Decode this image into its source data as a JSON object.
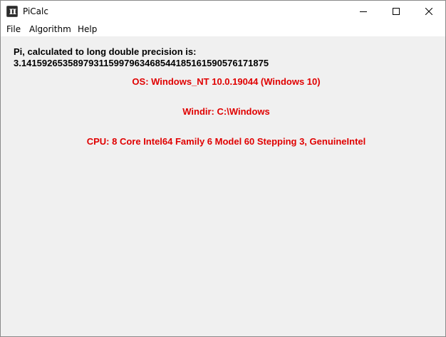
{
  "window": {
    "title": "PiCalc",
    "icon": "pi-icon"
  },
  "menu": {
    "file": "File",
    "algorithm": "Algorithm",
    "help": "Help"
  },
  "content": {
    "pi_label": "Pi, calculated to long double precision is:",
    "pi_value": "3.14159265358979311599796346854418516159057617187​5",
    "os": "OS: Windows_NT 10.0.19044 (Windows 10)",
    "windir": "Windir: C:\\Windows",
    "cpu": "CPU: 8 Core Intel64 Family 6 Model 60 Stepping 3, GenuineIntel"
  },
  "colors": {
    "info_text": "#e00000",
    "background": "#f0f0f0"
  }
}
